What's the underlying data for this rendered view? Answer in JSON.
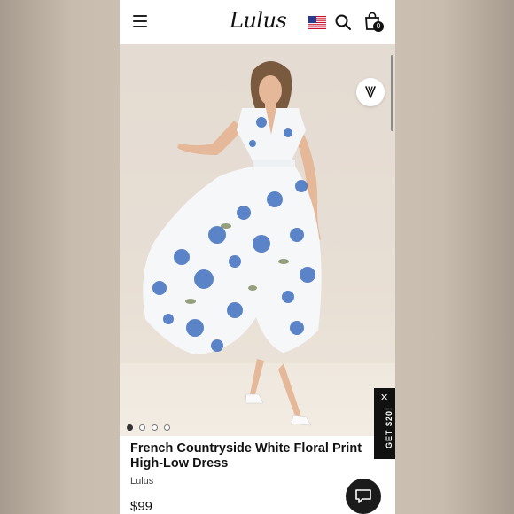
{
  "header": {
    "logo_text": "Lulus",
    "menu_icon": "hamburger-icon",
    "flag_icon": "us-flag-icon",
    "search_icon": "search-icon",
    "bag_icon": "shopping-bag-icon",
    "bag_count": "0"
  },
  "gallery": {
    "image_subject": "dress-photo",
    "dots": [
      {
        "active": true
      },
      {
        "active": false
      },
      {
        "active": false
      },
      {
        "active": false
      }
    ],
    "wishlist_icon": "heart-v-icon"
  },
  "promo": {
    "label": "GET $20!",
    "close_symbol": "✕"
  },
  "product": {
    "title": "French Countryside White Floral Print High-Low Dress",
    "brand": "Lulus",
    "price": "$99"
  },
  "chat": {
    "icon": "chat-bubble-icon"
  },
  "colors": {
    "accent": "#111111",
    "background": "#ffffff",
    "floral_blue": "#3f6fc0"
  }
}
